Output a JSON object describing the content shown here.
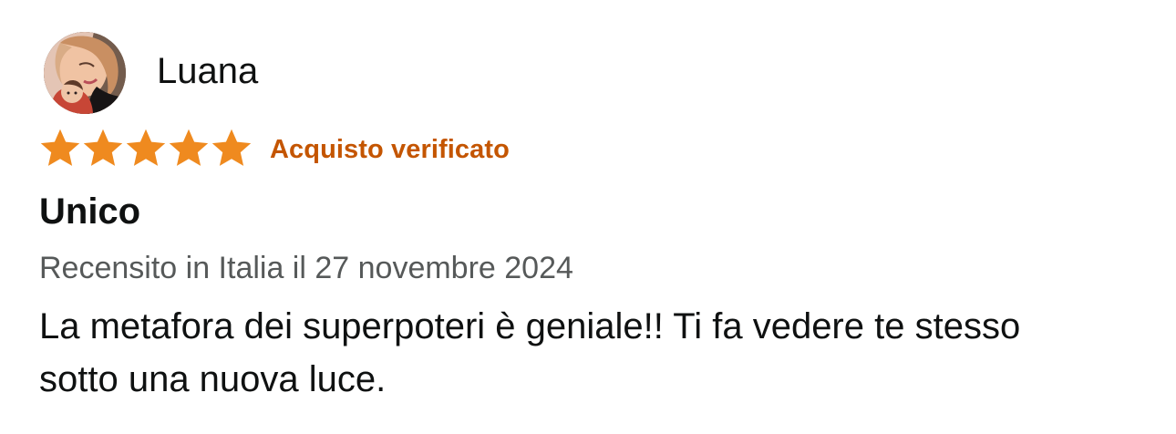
{
  "review": {
    "reviewer": {
      "name": "Luana",
      "avatar": "user-avatar-photo"
    },
    "rating": {
      "stars": 5,
      "max": 5,
      "star_icon": "star-icon",
      "star_color": "#ef8a1f"
    },
    "verified_label": "Acquisto verificato",
    "title": "Unico",
    "date_line": "Recensito in Italia il 27 novembre 2024",
    "body": "La metafora dei superpoteri è geniale!! Ti fa vedere te stesso sotto una nuova luce."
  },
  "colors": {
    "verified": "#c45500",
    "text": "#0f1111",
    "secondary_text": "#565959"
  }
}
